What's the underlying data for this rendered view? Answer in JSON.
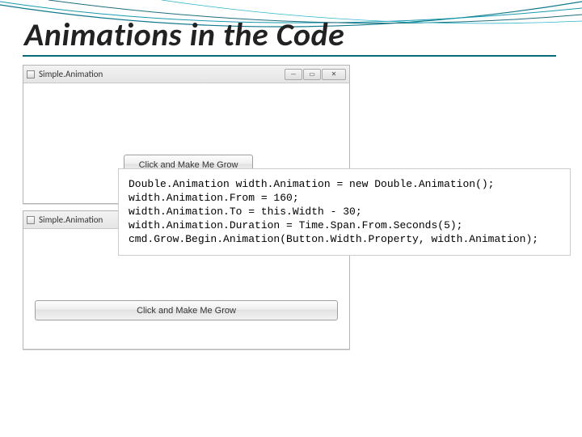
{
  "slide": {
    "title": "Animations in the Code"
  },
  "window1": {
    "caption": "Simple.Animation",
    "button_label": "Click and Make Me Grow"
  },
  "window2": {
    "caption": "Simple.Animation",
    "button_label": "Click and Make Me Grow"
  },
  "code": {
    "line1": "Double.Animation width.Animation = new Double.Animation();",
    "line2": "width.Animation.From = 160;",
    "line3": "width.Animation.To = this.Width - 30;",
    "line4": "width.Animation.Duration = Time.Span.From.Seconds(5);",
    "line5": "cmd.Grow.Begin.Animation(Button.Width.Property, width.Animation);"
  },
  "winbuttons": {
    "min": "—",
    "max": "▭",
    "close": "✕"
  }
}
